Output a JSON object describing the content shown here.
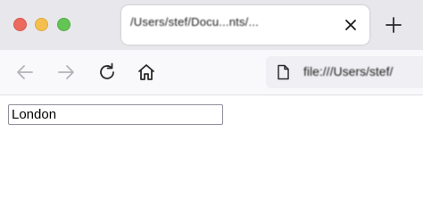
{
  "tab": {
    "title": "/Users/stef/Docu...nts/...",
    "close_icon": "close-icon"
  },
  "toolbar": {
    "new_tab_icon": "plus-icon",
    "back_icon": "arrow-left-icon",
    "forward_icon": "arrow-right-icon",
    "reload_icon": "reload-icon",
    "home_icon": "home-icon",
    "page_icon": "page-icon",
    "url_text": "file:///Users/stef/"
  },
  "window_controls": {
    "close_color": "#ed6a5e",
    "minimize_color": "#f5bf4f",
    "maximize_color": "#62c554"
  },
  "form": {
    "city_value": "London"
  }
}
